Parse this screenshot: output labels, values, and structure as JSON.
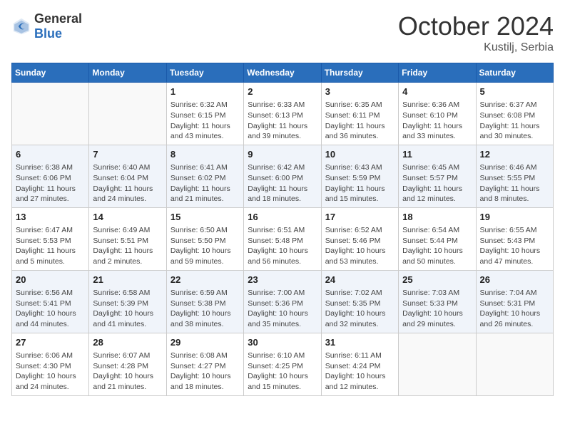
{
  "header": {
    "logo_general": "General",
    "logo_blue": "Blue",
    "month": "October 2024",
    "location": "Kustilj, Serbia"
  },
  "days_of_week": [
    "Sunday",
    "Monday",
    "Tuesday",
    "Wednesday",
    "Thursday",
    "Friday",
    "Saturday"
  ],
  "weeks": [
    [
      {
        "day": "",
        "info": ""
      },
      {
        "day": "",
        "info": ""
      },
      {
        "day": "1",
        "info": "Sunrise: 6:32 AM\nSunset: 6:15 PM\nDaylight: 11 hours and 43 minutes."
      },
      {
        "day": "2",
        "info": "Sunrise: 6:33 AM\nSunset: 6:13 PM\nDaylight: 11 hours and 39 minutes."
      },
      {
        "day": "3",
        "info": "Sunrise: 6:35 AM\nSunset: 6:11 PM\nDaylight: 11 hours and 36 minutes."
      },
      {
        "day": "4",
        "info": "Sunrise: 6:36 AM\nSunset: 6:10 PM\nDaylight: 11 hours and 33 minutes."
      },
      {
        "day": "5",
        "info": "Sunrise: 6:37 AM\nSunset: 6:08 PM\nDaylight: 11 hours and 30 minutes."
      }
    ],
    [
      {
        "day": "6",
        "info": "Sunrise: 6:38 AM\nSunset: 6:06 PM\nDaylight: 11 hours and 27 minutes."
      },
      {
        "day": "7",
        "info": "Sunrise: 6:40 AM\nSunset: 6:04 PM\nDaylight: 11 hours and 24 minutes."
      },
      {
        "day": "8",
        "info": "Sunrise: 6:41 AM\nSunset: 6:02 PM\nDaylight: 11 hours and 21 minutes."
      },
      {
        "day": "9",
        "info": "Sunrise: 6:42 AM\nSunset: 6:00 PM\nDaylight: 11 hours and 18 minutes."
      },
      {
        "day": "10",
        "info": "Sunrise: 6:43 AM\nSunset: 5:59 PM\nDaylight: 11 hours and 15 minutes."
      },
      {
        "day": "11",
        "info": "Sunrise: 6:45 AM\nSunset: 5:57 PM\nDaylight: 11 hours and 12 minutes."
      },
      {
        "day": "12",
        "info": "Sunrise: 6:46 AM\nSunset: 5:55 PM\nDaylight: 11 hours and 8 minutes."
      }
    ],
    [
      {
        "day": "13",
        "info": "Sunrise: 6:47 AM\nSunset: 5:53 PM\nDaylight: 11 hours and 5 minutes."
      },
      {
        "day": "14",
        "info": "Sunrise: 6:49 AM\nSunset: 5:51 PM\nDaylight: 11 hours and 2 minutes."
      },
      {
        "day": "15",
        "info": "Sunrise: 6:50 AM\nSunset: 5:50 PM\nDaylight: 10 hours and 59 minutes."
      },
      {
        "day": "16",
        "info": "Sunrise: 6:51 AM\nSunset: 5:48 PM\nDaylight: 10 hours and 56 minutes."
      },
      {
        "day": "17",
        "info": "Sunrise: 6:52 AM\nSunset: 5:46 PM\nDaylight: 10 hours and 53 minutes."
      },
      {
        "day": "18",
        "info": "Sunrise: 6:54 AM\nSunset: 5:44 PM\nDaylight: 10 hours and 50 minutes."
      },
      {
        "day": "19",
        "info": "Sunrise: 6:55 AM\nSunset: 5:43 PM\nDaylight: 10 hours and 47 minutes."
      }
    ],
    [
      {
        "day": "20",
        "info": "Sunrise: 6:56 AM\nSunset: 5:41 PM\nDaylight: 10 hours and 44 minutes."
      },
      {
        "day": "21",
        "info": "Sunrise: 6:58 AM\nSunset: 5:39 PM\nDaylight: 10 hours and 41 minutes."
      },
      {
        "day": "22",
        "info": "Sunrise: 6:59 AM\nSunset: 5:38 PM\nDaylight: 10 hours and 38 minutes."
      },
      {
        "day": "23",
        "info": "Sunrise: 7:00 AM\nSunset: 5:36 PM\nDaylight: 10 hours and 35 minutes."
      },
      {
        "day": "24",
        "info": "Sunrise: 7:02 AM\nSunset: 5:35 PM\nDaylight: 10 hours and 32 minutes."
      },
      {
        "day": "25",
        "info": "Sunrise: 7:03 AM\nSunset: 5:33 PM\nDaylight: 10 hours and 29 minutes."
      },
      {
        "day": "26",
        "info": "Sunrise: 7:04 AM\nSunset: 5:31 PM\nDaylight: 10 hours and 26 minutes."
      }
    ],
    [
      {
        "day": "27",
        "info": "Sunrise: 6:06 AM\nSunset: 4:30 PM\nDaylight: 10 hours and 24 minutes."
      },
      {
        "day": "28",
        "info": "Sunrise: 6:07 AM\nSunset: 4:28 PM\nDaylight: 10 hours and 21 minutes."
      },
      {
        "day": "29",
        "info": "Sunrise: 6:08 AM\nSunset: 4:27 PM\nDaylight: 10 hours and 18 minutes."
      },
      {
        "day": "30",
        "info": "Sunrise: 6:10 AM\nSunset: 4:25 PM\nDaylight: 10 hours and 15 minutes."
      },
      {
        "day": "31",
        "info": "Sunrise: 6:11 AM\nSunset: 4:24 PM\nDaylight: 10 hours and 12 minutes."
      },
      {
        "day": "",
        "info": ""
      },
      {
        "day": "",
        "info": ""
      }
    ]
  ]
}
